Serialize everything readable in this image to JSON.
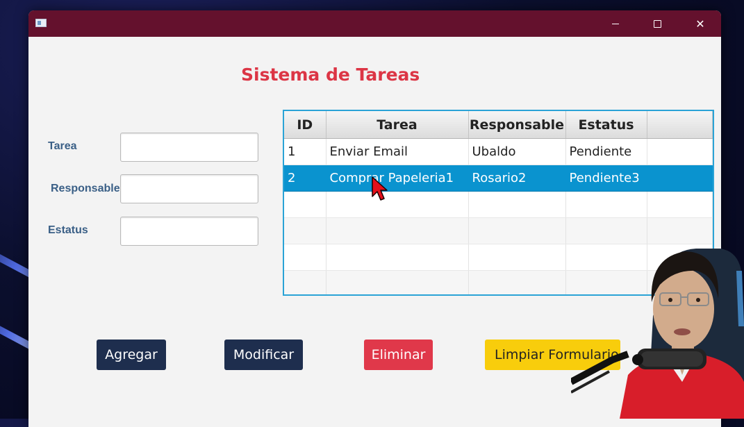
{
  "window": {
    "title_bar_color": "#64112d",
    "controls": [
      "minimize-icon",
      "maximize-icon",
      "close-icon"
    ]
  },
  "app": {
    "title": "Sistema de Tareas",
    "title_color": "#dc3545"
  },
  "form": {
    "tarea_label": "Tarea",
    "tarea_value": "",
    "responsable_label": "Responsable",
    "responsable_value": "",
    "estatus_label": "Estatus",
    "estatus_value": ""
  },
  "table": {
    "columns": [
      "ID",
      "Tarea",
      "Responsable",
      "Estatus",
      ""
    ],
    "rows": [
      {
        "id": "1",
        "tarea": "Enviar Email",
        "responsable": "Ubaldo",
        "estatus": "Pendiente"
      },
      {
        "id": "2",
        "tarea": "Comprar Papeleria1",
        "responsable": "Rosario2",
        "estatus": "Pendiente3"
      }
    ],
    "selected_row": 2,
    "selection_color": "#0a93cf"
  },
  "buttons": {
    "add": "Agregar",
    "modify": "Modificar",
    "delete": "Eliminar",
    "clear": "Limpiar Formulario"
  },
  "button_colors": {
    "primary": "#1e2e4e",
    "danger": "#e0384a",
    "warning": "#f8cd0c"
  }
}
